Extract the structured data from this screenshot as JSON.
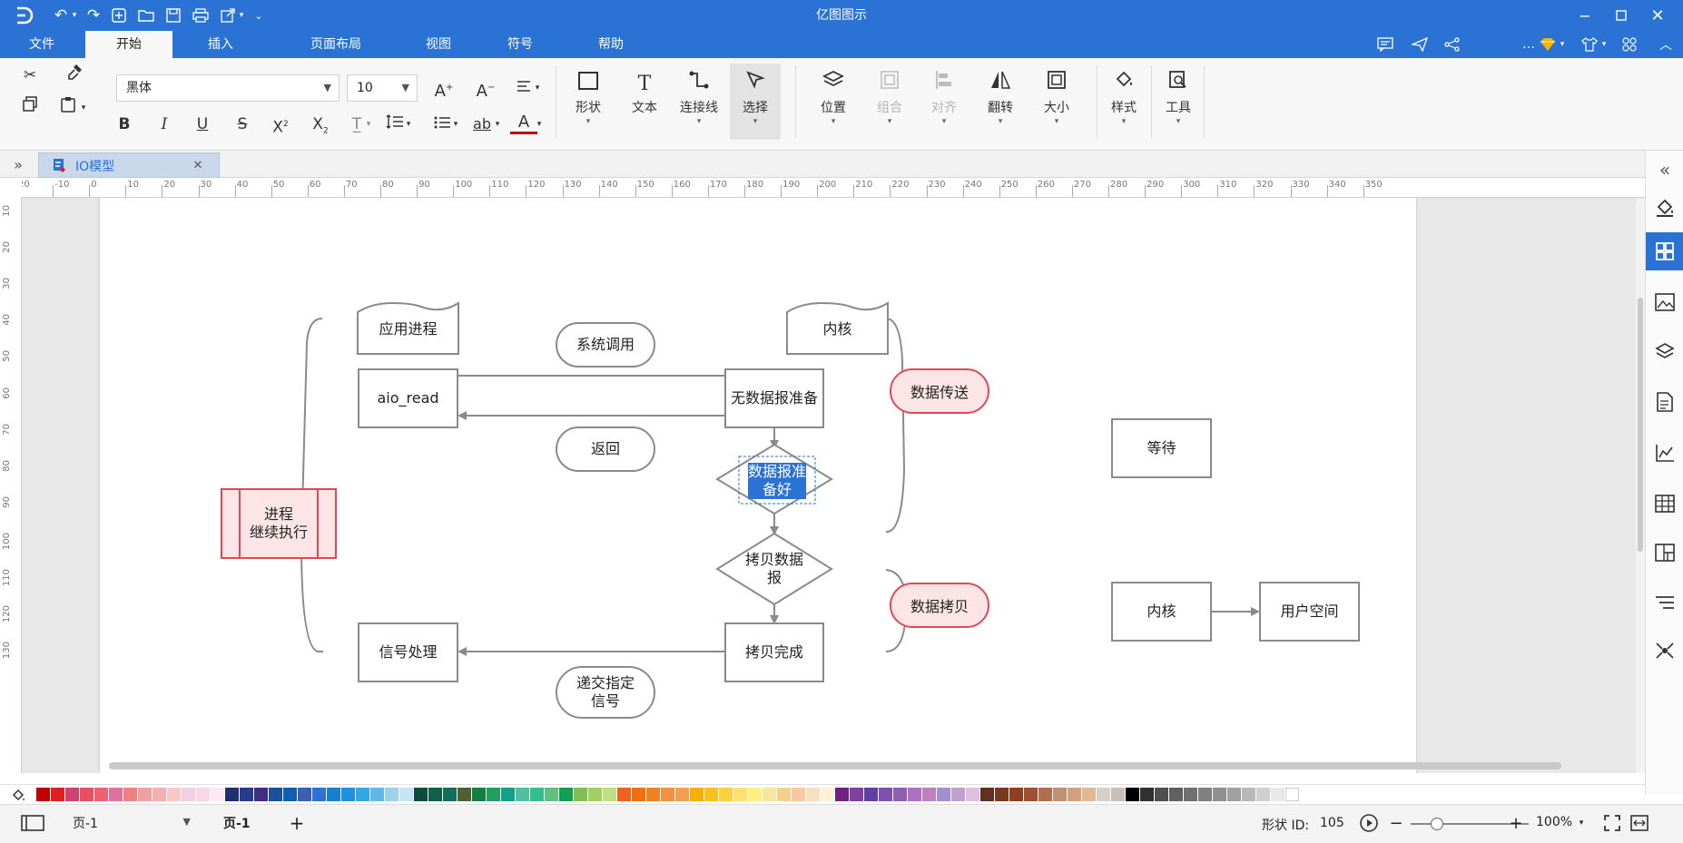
{
  "app": {
    "title": "亿图图示"
  },
  "menu": {
    "items": [
      "文件",
      "开始",
      "插入",
      "页面布局",
      "视图",
      "符号",
      "帮助"
    ],
    "active": "开始"
  },
  "ribbon": {
    "font_name": "黑体",
    "font_size": "10",
    "big_buttons": [
      "形状",
      "文本",
      "连接线",
      "选择",
      "位置",
      "组合",
      "对齐",
      "翻转",
      "大小",
      "样式",
      "工具"
    ]
  },
  "doc_tab": {
    "name": "IO模型"
  },
  "ruler": {
    "h_ticks": [
      "20",
      "-10",
      "0",
      "10",
      "20",
      "30",
      "40",
      "50",
      "60",
      "70",
      "80",
      "90",
      "100",
      "110",
      "120",
      "130",
      "140",
      "150",
      "160",
      "170",
      "180",
      "190",
      "200",
      "210",
      "220",
      "230",
      "240",
      "250",
      "260",
      "270",
      "280",
      "290",
      "300",
      "310",
      "320",
      "330",
      "340",
      "350"
    ],
    "v_ticks": [
      "10",
      "20",
      "30",
      "40",
      "50",
      "60",
      "70",
      "80",
      "90",
      "100",
      "110",
      "120",
      "130"
    ]
  },
  "diagram": {
    "app_process": "应用进程",
    "aio_read": "aio_read",
    "signal_handling": "信号处理",
    "syscall": "系统调用",
    "return": "返回",
    "deliver_signal": "递交指定\n信号",
    "kernel": "内核",
    "no_data_ready": "无数据报准备",
    "data_ready": "数据报准\n备好",
    "copy_data": "拷贝数据\n报",
    "copy_done": "拷贝完成",
    "continue_exec": "进程\n继续执行",
    "data_transfer": "数据传送",
    "data_copy": "数据拷贝",
    "wait": "等待",
    "kernel2": "内核",
    "user_space": "用户空间"
  },
  "status": {
    "page_selector": "页-1",
    "page_tab": "页-1",
    "shape_id_label": "形状 ID:",
    "shape_id": "105",
    "zoom": "100%"
  },
  "palette": [
    "#c00000",
    "#e02020",
    "#d04070",
    "#e85060",
    "#f06070",
    "#e070a0",
    "#f08080",
    "#f0a0a0",
    "#f4b0b0",
    "#f8c8c8",
    "#f2d0e0",
    "#f8d8e8",
    "#fce8f0",
    "#1f2f6f",
    "#283c8c",
    "#3c2f80",
    "#1c4f9f",
    "#1060b0",
    "#3c5fb0",
    "#2a72d4",
    "#1780d0",
    "#2090e0",
    "#30a8e0",
    "#60b8e8",
    "#9dd0ef",
    "#c8e4f4",
    "#0b4d3b",
    "#0f6048",
    "#11705a",
    "#506030",
    "#118040",
    "#20a060",
    "#11a08a",
    "#50c0a0",
    "#30c090",
    "#60c080",
    "#10a050",
    "#80c050",
    "#a0d060",
    "#c0e080",
    "#f06020",
    "#f07010",
    "#f08020",
    "#f09040",
    "#f0a050",
    "#f8b000",
    "#f8c020",
    "#f8d040",
    "#fce070",
    "#fff080",
    "#f5e6a0",
    "#f6d090",
    "#f8c8a0",
    "#fbe0c0",
    "#fff0d8",
    "#702080",
    "#8040a0",
    "#6040a0",
    "#8050b0",
    "#9060b0",
    "#b070c0",
    "#c080c0",
    "#a090d0",
    "#c0a0d0",
    "#e0c0e0",
    "#603020",
    "#7a3a20",
    "#904020",
    "#a05030",
    "#b07050",
    "#c09070",
    "#d0a080",
    "#e0b890",
    "#d8d0c8",
    "#c8c0b8",
    "#000000",
    "#303030",
    "#505050",
    "#606060",
    "#707070",
    "#808080",
    "#909090",
    "#a0a0a0",
    "#b8b8b8",
    "#d0d0d0",
    "#e8e8e8",
    "#ffffff"
  ]
}
